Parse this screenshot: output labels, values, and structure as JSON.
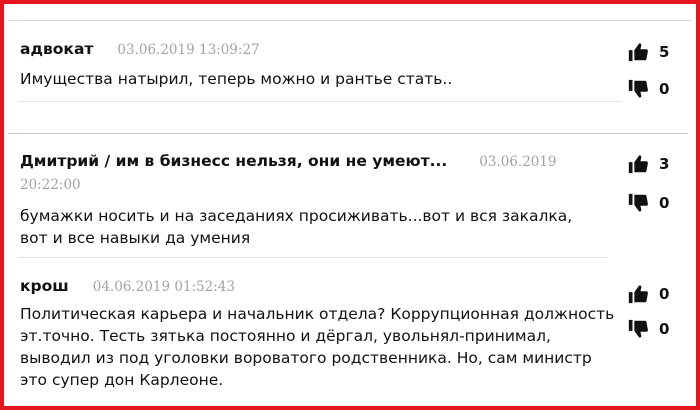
{
  "comments": [
    {
      "author": "адвокат",
      "date": "03.06.2019 13:09:27",
      "text": "Имущества натырил, теперь можно и рантье стать..",
      "likes": "5",
      "dislikes": "0"
    },
    {
      "author": "Дмитрий / им в бизнесс нельзя, они не умеют...",
      "date": "03.06.2019 20:22:00",
      "text": "бумажки носить и на заседаниях просиживать...вот и вся закалка, вот и все навыки да умения",
      "likes": "3",
      "dislikes": "0"
    },
    {
      "author": "крош",
      "date": "04.06.2019 01:52:43",
      "text": "Политическая карьера и начальник отдела? Коррупционная должность эт.точно. Тесть зятька постоянно и дёргал, увольнял-принимал, выводил из под уголовки вороватого родственника. Но, сам министр это супер дон Карлеоне.",
      "likes": "0",
      "dislikes": "0"
    }
  ],
  "colors": {
    "border": "#e5161d",
    "date": "#a2a2a2"
  },
  "icons": {
    "like": "thumbs-up-icon",
    "dislike": "thumbs-down-icon"
  }
}
